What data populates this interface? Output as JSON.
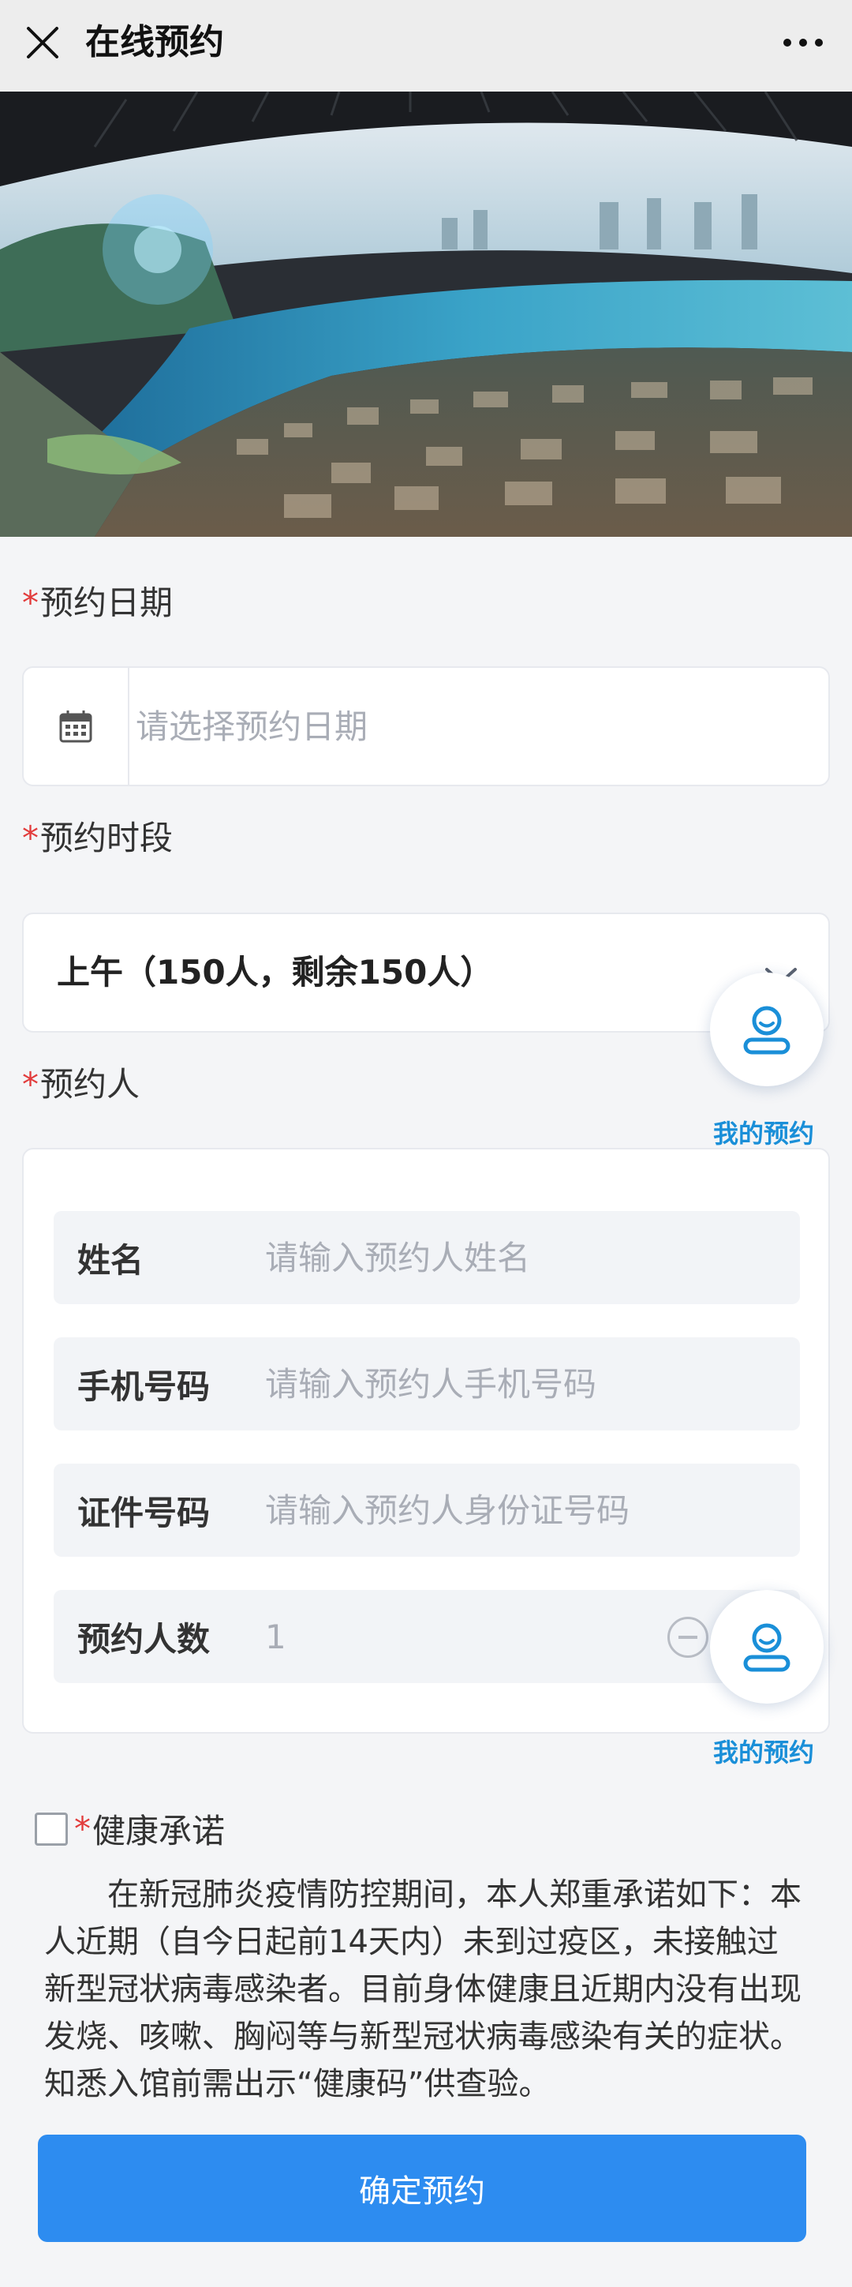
{
  "header": {
    "title": "在线预约"
  },
  "date_section": {
    "label": "预约日期",
    "placeholder": "请选择预约日期"
  },
  "time_section": {
    "label": "预约时段",
    "selected": "上午（150人，剩余150人）"
  },
  "person_section": {
    "label": "预约人",
    "fields": [
      {
        "label": "姓名",
        "placeholder": "请输入预约人姓名"
      },
      {
        "label": "手机号码",
        "placeholder": "请输入预约人手机号码"
      },
      {
        "label": "证件号码",
        "placeholder": "请输入预约人身份证号码"
      }
    ],
    "count": {
      "label": "预约人数",
      "value": "1"
    }
  },
  "floating": {
    "my_booking_label": "我的预约"
  },
  "promise": {
    "title": "健康承诺",
    "text": "在新冠肺炎疫情防控期间，本人郑重承诺如下：本人近期（自今日起前14天内）未到过疫区，未接触过新型冠状病毒感染者。目前身体健康且近期内没有出现发烧、咳嗽、胸闷等与新型冠状病毒感染有关的症状。知悉入馆前需出示“健康码”供查验。"
  },
  "submit": {
    "label": "确定预约"
  },
  "required_mark": "*",
  "colors": {
    "primary": "#2d8cf0",
    "required": "#e23c3c",
    "float_label": "#1a8fd8"
  }
}
